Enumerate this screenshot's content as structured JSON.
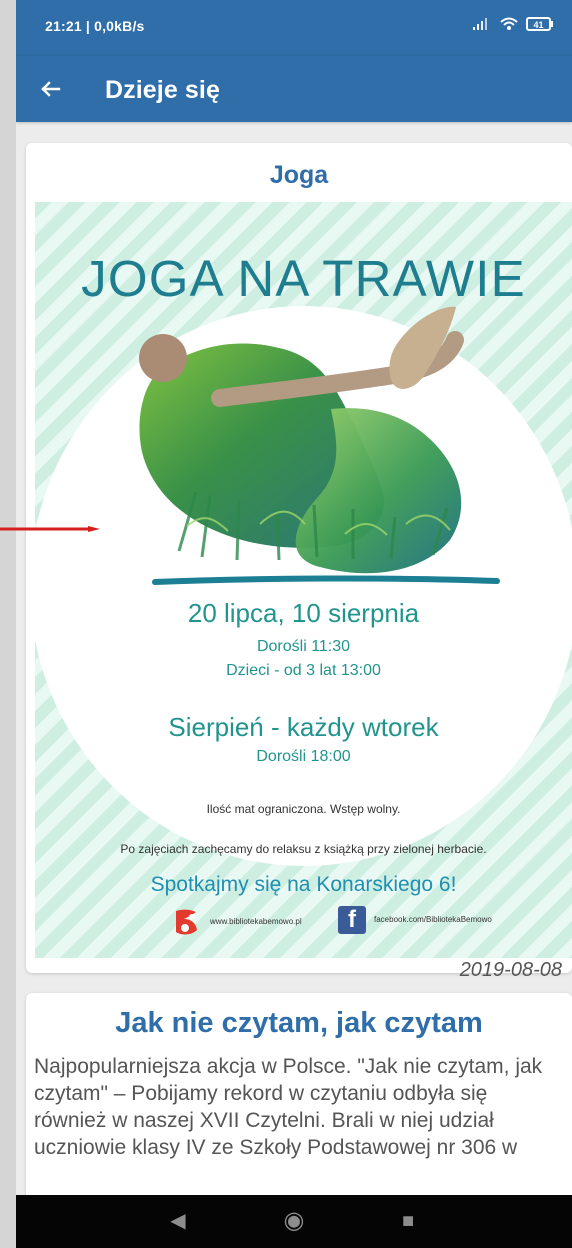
{
  "status_bar": {
    "time": "21:21 | 0,0kB/s",
    "battery": "41"
  },
  "toolbar": {
    "title": "Dzieje się"
  },
  "cards": [
    {
      "title": "Joga",
      "poster": {
        "heading": "JOGA NA TRAWIE",
        "dates": "20 lipca, 10 sierpnia",
        "adults_time": "Dorośli 11:30",
        "kids_time": "Dzieci - od 3 lat 13:00",
        "august": "Sierpień - każdy wtorek",
        "august_adults": "Dorośli 18:00",
        "note1": "Ilość mat ograniczona. Wstęp wolny.",
        "note2": "Po zajęciach zachęcamy do relaksu z książką przy zielonej herbacie.",
        "meet": "Spotkajmy się na Konarskiego 6!",
        "website": "www.bibliotekabemowo.pl",
        "facebook": "facebook.com/BibliotekaBemowo"
      },
      "date": "2019-08-08"
    },
    {
      "title": "Jak nie czytam, jak czytam",
      "description": "Najpopularniejsza akcja w Polsce. \"Jak nie czytam, jak czytam\" – Pobijamy rekord w czytaniu odbyła się również w naszej XVII Czytelni. Brali w niej udział uczniowie klasy IV ze Szkoły Podstawowej nr 306 w"
    }
  ],
  "icons": {
    "back": "arrow-left-icon",
    "signal": "signal-icon",
    "wifi": "wifi-icon",
    "battery": "battery-icon",
    "library_logo": "library-logo-icon",
    "facebook": "facebook-icon",
    "nav_back": "triangle-left-icon",
    "nav_home": "circle-home-icon",
    "nav_recent": "square-recent-icon"
  },
  "colors": {
    "primary": "#2f6ea8",
    "poster_accent": "#22948e",
    "poster_stripe": "#cfeee2",
    "arrow": "#d61f1f"
  }
}
